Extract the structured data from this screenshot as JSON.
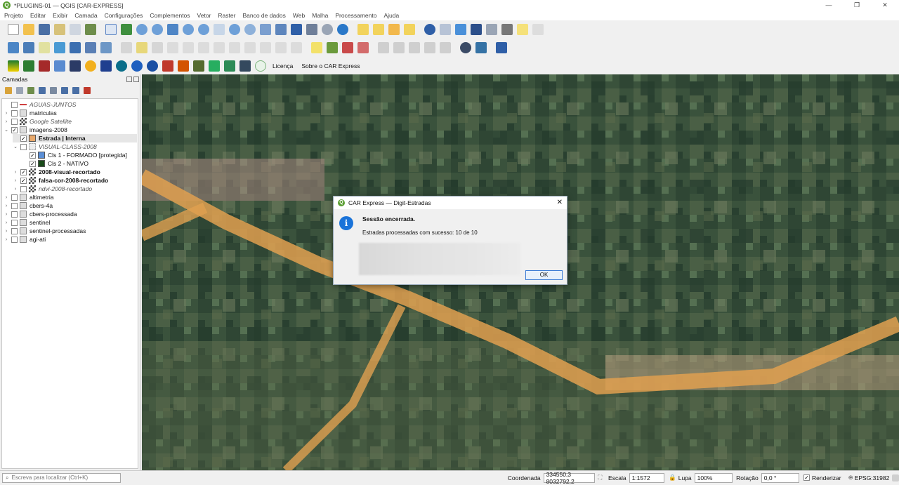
{
  "window": {
    "title": "*PLUGINS-01 — QGIS [CAR-EXPRESS]",
    "app_icon": "qgis-logo",
    "controls": [
      "—",
      "❐",
      "✕"
    ]
  },
  "menu": [
    "Projeto",
    "Editar",
    "Exibir",
    "Camada",
    "Configurações",
    "Complementos",
    "Vetor",
    "Raster",
    "Banco de dados",
    "Web",
    "Malha",
    "Processamento",
    "Ajuda"
  ],
  "toolbar3": {
    "license": "Licença",
    "about": "Sobre o CAR Express"
  },
  "layers_panel": {
    "title": "Camadas",
    "layers": [
      {
        "name": "AGUAS-JUNTOS",
        "style": "italic",
        "indent": 0,
        "arrow": "",
        "checked": false,
        "icon": "line-symbol-icon",
        "color": "#d04040"
      },
      {
        "name": "matriculas",
        "style": "normal",
        "indent": 0,
        "arrow": "›",
        "checked": false,
        "icon": "group-icon",
        "color": "#888888"
      },
      {
        "name": "Google Satellite",
        "style": "italic",
        "indent": 0,
        "arrow": "›",
        "checked": false,
        "icon": "raster-icon",
        "color": "#444444"
      },
      {
        "name": "imagens-2008",
        "style": "normal",
        "indent": 0,
        "arrow": "⌄",
        "checked": true,
        "icon": "group-icon",
        "color": "#888888"
      },
      {
        "name": "Estrada | Interna",
        "style": "bold",
        "indent": 1,
        "arrow": "",
        "checked": true,
        "icon": "fill-symbol-icon",
        "color": "#e9a96b",
        "selected": true
      },
      {
        "name": "VISUAL-CLASS-2008",
        "style": "italic",
        "indent": 1,
        "arrow": "⌄",
        "checked": false,
        "icon": "polygon-layer-icon",
        "color": "#aaaaaa"
      },
      {
        "name": "Cls 1 - FORMADO [protegida]",
        "style": "normal",
        "indent": 2,
        "arrow": "",
        "checked": true,
        "icon": "fill-symbol-icon",
        "color": "#5b8fd6"
      },
      {
        "name": "Cls 2 - NATIVO",
        "style": "normal",
        "indent": 2,
        "arrow": "",
        "checked": true,
        "icon": "fill-symbol-icon",
        "color": "#1a4b1a"
      },
      {
        "name": "2008-visual-recortado",
        "style": "bold",
        "indent": 1,
        "arrow": "›",
        "checked": true,
        "icon": "raster-icon",
        "color": "#444444"
      },
      {
        "name": "falsa-cor-2008-recortado",
        "style": "bold",
        "indent": 1,
        "arrow": "›",
        "checked": true,
        "icon": "raster-icon",
        "color": "#444444"
      },
      {
        "name": "ndvi-2008-recortado",
        "style": "italic",
        "indent": 1,
        "arrow": "›",
        "checked": false,
        "icon": "raster-icon",
        "color": "#444444"
      },
      {
        "name": "altimetria",
        "style": "normal",
        "indent": 0,
        "arrow": "›",
        "checked": false,
        "icon": "group-icon",
        "color": "#888888"
      },
      {
        "name": "cbers-4a",
        "style": "normal",
        "indent": 0,
        "arrow": "›",
        "checked": false,
        "icon": "group-icon",
        "color": "#888888"
      },
      {
        "name": "cbers-processada",
        "style": "normal",
        "indent": 0,
        "arrow": "›",
        "checked": false,
        "icon": "group-icon",
        "color": "#888888"
      },
      {
        "name": "sentinel",
        "style": "normal",
        "indent": 0,
        "arrow": "›",
        "checked": false,
        "icon": "group-icon",
        "color": "#888888"
      },
      {
        "name": "sentinel-processadas",
        "style": "normal",
        "indent": 0,
        "arrow": "›",
        "checked": false,
        "icon": "group-icon",
        "color": "#888888"
      },
      {
        "name": "agi-ati",
        "style": "normal",
        "indent": 0,
        "arrow": "›",
        "checked": false,
        "icon": "group-icon",
        "color": "#888888"
      }
    ]
  },
  "dialog": {
    "title": "CAR Express — Digit-Estradas",
    "message": "Sessão encerrada.",
    "info": "Estradas processadas com sucesso: 10 de 10",
    "ok": "OK"
  },
  "statusbar": {
    "search_placeholder": "Escreva para localizar (Ctrl+K)",
    "coord_label": "Coordenada",
    "coord_value": "334550,3  8032792,2",
    "scale_label": "Escala",
    "scale_value": "1:1572",
    "zoom_label": "Lupa",
    "zoom_value": "100%",
    "rotation_label": "Rotação",
    "rotation_value": "0,0 °",
    "render_label": "Renderizar",
    "crs": "EPSG:31982"
  }
}
